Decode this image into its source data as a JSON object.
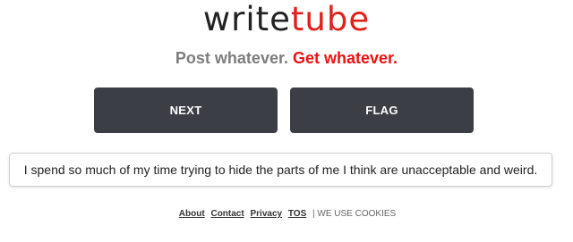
{
  "brand": {
    "logo_part1": "write",
    "logo_part2": "tube",
    "colors": {
      "logo_dark": "#222222",
      "logo_red": "#e0201b",
      "tagline_gray": "#7d7d7d",
      "tagline_red": "#ef1111",
      "button_bg": "#3b3e44"
    }
  },
  "tagline": {
    "part1": "Post whatever.",
    "part2": "Get whatever."
  },
  "actions": {
    "next_label": "NEXT",
    "flag_label": "FLAG"
  },
  "message": {
    "text": "I spend so much of my time trying to hide the parts of me I think are unacceptable and weird."
  },
  "footer": {
    "about": "About",
    "contact": "Contact",
    "privacy": "Privacy",
    "tos": "TOS",
    "cookies_notice": "| WE USE COOKIES"
  }
}
